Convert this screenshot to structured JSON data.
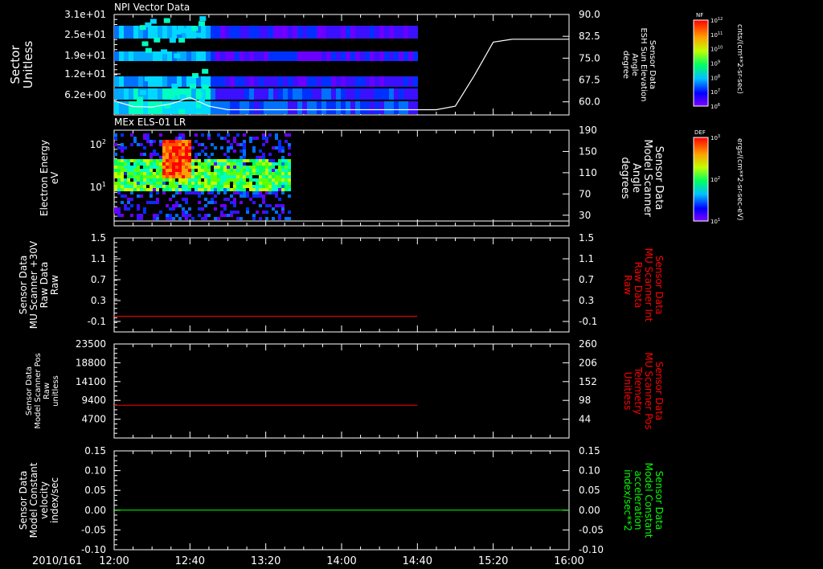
{
  "colors": {
    "background": "#000000",
    "foreground": "#ffffff",
    "red": "#ff0000",
    "green": "#00ff00"
  },
  "time_axis": {
    "date_label": "2010/161",
    "ticks": [
      "12:00",
      "12:40",
      "13:20",
      "14:00",
      "14:40",
      "15:20",
      "16:00"
    ]
  },
  "chart_data": [
    {
      "type": "heatmap",
      "title": "NPI Vector Data",
      "ylabel": [
        "Sector",
        "Unitless"
      ],
      "yticks": [
        "3.1e+01",
        "2.5e+01",
        "1.9e+01",
        "1.2e+01",
        "6.2e+00"
      ],
      "right_axis": {
        "label": [
          "Sensor Data",
          "ESH Sun Elevation",
          "Angle",
          "degree"
        ],
        "ticks": [
          "90.0",
          "82.5",
          "75.0",
          "67.5",
          "60.0"
        ],
        "ylim": [
          55.5,
          90.0
        ],
        "line_series": {
          "color": "#ffffff",
          "x": [
            "12:00",
            "12:10",
            "12:20",
            "12:30",
            "12:40",
            "12:50",
            "13:00",
            "13:30",
            "14:00",
            "14:30",
            "14:50",
            "15:00",
            "15:10",
            "15:20",
            "15:30",
            "16:00"
          ],
          "y": [
            60.3,
            58.4,
            58.2,
            59.3,
            61.5,
            58.5,
            57.3,
            57.3,
            57.3,
            57.3,
            57.3,
            58.5,
            69.0,
            80.5,
            81.5,
            81.5
          ]
        }
      },
      "colorbar": {
        "name": "NF",
        "units": "cnts/(cm**2-sr-sec)",
        "tick_labels": [
          "10^12",
          "10^11",
          "10^10",
          "10^9",
          "10^8",
          "10^7",
          "10^6"
        ]
      },
      "data_extent_x": [
        "12:00",
        "14:39"
      ]
    },
    {
      "type": "heatmap",
      "title": "MEx ELS-01 LR",
      "ylabel": [
        "Electron Energy",
        "eV"
      ],
      "yticks": [
        "10^2",
        "10^1"
      ],
      "right_axis": {
        "label": [
          "Sensor Data",
          "Model Scanner",
          "Angle",
          "degrees"
        ],
        "ticks": [
          "190",
          "150",
          "110",
          "70",
          "30"
        ],
        "ylim": [
          10,
          190
        ],
        "line_series": {
          "color": "#ffffff",
          "x": [
            "12:00",
            "16:00"
          ],
          "y": [
            10,
            10
          ]
        }
      },
      "colorbar": {
        "name": "DEF",
        "units": "ergs/(cm**2-sr-sec-eV)",
        "tick_labels": [
          "10^3",
          "10^2",
          "10^1"
        ]
      },
      "data_extent_x": [
        "12:00",
        "13:33"
      ]
    },
    {
      "type": "line",
      "ylabel": [
        "Sensor Data",
        "MU Scanner +30V",
        "Raw Data",
        "Raw"
      ],
      "yticks": [
        "1.5",
        "1.1",
        "0.7",
        "0.3",
        "-0.1"
      ],
      "ylim": [
        -0.3,
        1.5
      ],
      "right_axis": {
        "label": [
          "Sensor Data",
          "MU Scanner Int",
          "Raw Data",
          "Raw"
        ],
        "ticks": [
          "1.5",
          "1.1",
          "0.7",
          "0.3",
          "-0.1"
        ],
        "label_color": "#ff0000"
      },
      "series": [
        {
          "color": "#ff0000",
          "x": [
            "12:00",
            "14:40"
          ],
          "y": [
            0.0,
            0.0
          ]
        }
      ]
    },
    {
      "type": "line",
      "ylabel": [
        "Sensor Data",
        "Model Scanner Pos",
        "Raw",
        "unitless"
      ],
      "yticks": [
        "23500",
        "18800",
        "14100",
        "9400",
        "4700"
      ],
      "ylim": [
        0,
        23500
      ],
      "right_axis": {
        "label": [
          "Sensor Data",
          "MU Scanner Pos",
          "Telemetry",
          "Unitless"
        ],
        "ticks": [
          "260",
          "206",
          "152",
          "98",
          "44"
        ],
        "label_color": "#ff0000"
      },
      "series": [
        {
          "color": "#ff0000",
          "x": [
            "12:00",
            "14:40"
          ],
          "y": [
            8200,
            8200
          ]
        }
      ]
    },
    {
      "type": "line",
      "ylabel": [
        "Sensor Data",
        "Model Constant",
        "velocity",
        "index/sec"
      ],
      "yticks": [
        "0.15",
        "0.10",
        "0.05",
        "0.00",
        "-0.05",
        "-0.10"
      ],
      "ylim": [
        -0.1,
        0.15
      ],
      "right_axis": {
        "label": [
          "Sensor Data",
          "Model Constant",
          "acceleration",
          "index/sec**2"
        ],
        "ticks": [
          "0.15",
          "0.10",
          "0.05",
          "0.00",
          "-0.05",
          "-0.10"
        ],
        "label_color": "#00ff00"
      },
      "series": [
        {
          "color": "#00ff00",
          "x": [
            "12:00",
            "16:00"
          ],
          "y": [
            0.0,
            0.0
          ]
        }
      ]
    }
  ]
}
